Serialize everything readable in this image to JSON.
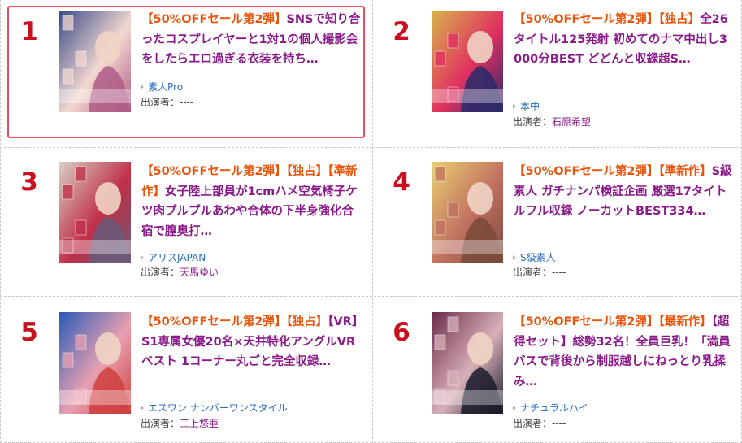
{
  "items": [
    {
      "rank": "1",
      "tags": [
        "【50%OFFセール第2弾】"
      ],
      "title": "SNSで知り合ったコスプレイヤーと1対1の個人撮影会をしたらエロ過ぎる衣装を持ち…",
      "maker": "素人Pro",
      "actors_label": "出演者：",
      "actors": "----",
      "actors_linked": false,
      "thumb_colors": [
        "#3a4a8a",
        "#f2d8d0",
        "#b05a86"
      ]
    },
    {
      "rank": "2",
      "tags": [
        "【50%OFFセール第2弾】",
        "【独占】"
      ],
      "title": "全26タイトル125発射 初めてのナマ中出し3000分BEST どどんと収録超S…",
      "maker": "本中",
      "actors_label": "出演者：",
      "actors": "石原希望",
      "actors_linked": true,
      "thumb_colors": [
        "#d8b44a",
        "#e03060",
        "#2a2a6a"
      ]
    },
    {
      "rank": "3",
      "tags": [
        "【50%OFFセール第2弾】",
        "【独占】",
        "【準新作】"
      ],
      "title": "女子陸上部員が1cmハメ空気椅子ケツ肉プルプルあわや合体の下半身強化合宿で膣奥打…",
      "maker": "アリスJAPAN",
      "actors_label": "出演者：",
      "actors": "天馬ゆい",
      "actors_linked": true,
      "thumb_colors": [
        "#d8cfc6",
        "#c03048",
        "#6a5a7a"
      ]
    },
    {
      "rank": "4",
      "tags": [
        "【50%OFFセール第2弾】",
        "【準新作】"
      ],
      "title": "S級素人 ガチナンパ検証企画 厳選17タイトルフル収録 ノーカットBEST334…",
      "maker": "S級素人",
      "actors_label": "出演者：",
      "actors": "----",
      "actors_linked": false,
      "thumb_colors": [
        "#e8d070",
        "#c07060",
        "#7a4a3a"
      ]
    },
    {
      "rank": "5",
      "tags": [
        "【50%OFFセール第2弾】",
        "【独占】"
      ],
      "title": "【VR】S1専属女優20名×天井特化アングルVRベスト 1コーナー丸ごと完全収録…",
      "maker": "エスワン ナンバーワンスタイル",
      "actors_label": "出演者：",
      "actors": "三上悠亜",
      "actors_linked": true,
      "thumb_colors": [
        "#2a5ab8",
        "#e8a0b0",
        "#d04040"
      ]
    },
    {
      "rank": "6",
      "tags": [
        "【50%OFFセール第2弾】",
        "【最新作】"
      ],
      "title": "【超得セット】総勢32名！全員巨乳！「満員バスで背後から制服越しにねっとり乳揉み…",
      "maker": "ナチュラルハイ",
      "actors_label": "出演者：",
      "actors": "----",
      "actors_linked": false,
      "thumb_colors": [
        "#6a2a4a",
        "#d8b0b8",
        "#1a1a2a"
      ]
    }
  ],
  "colors": {
    "rank": "#c8101e",
    "tag": "#e8540a",
    "title": "#8a1a8a",
    "maker": "#2a6db8",
    "highlight": "#e64c62"
  }
}
